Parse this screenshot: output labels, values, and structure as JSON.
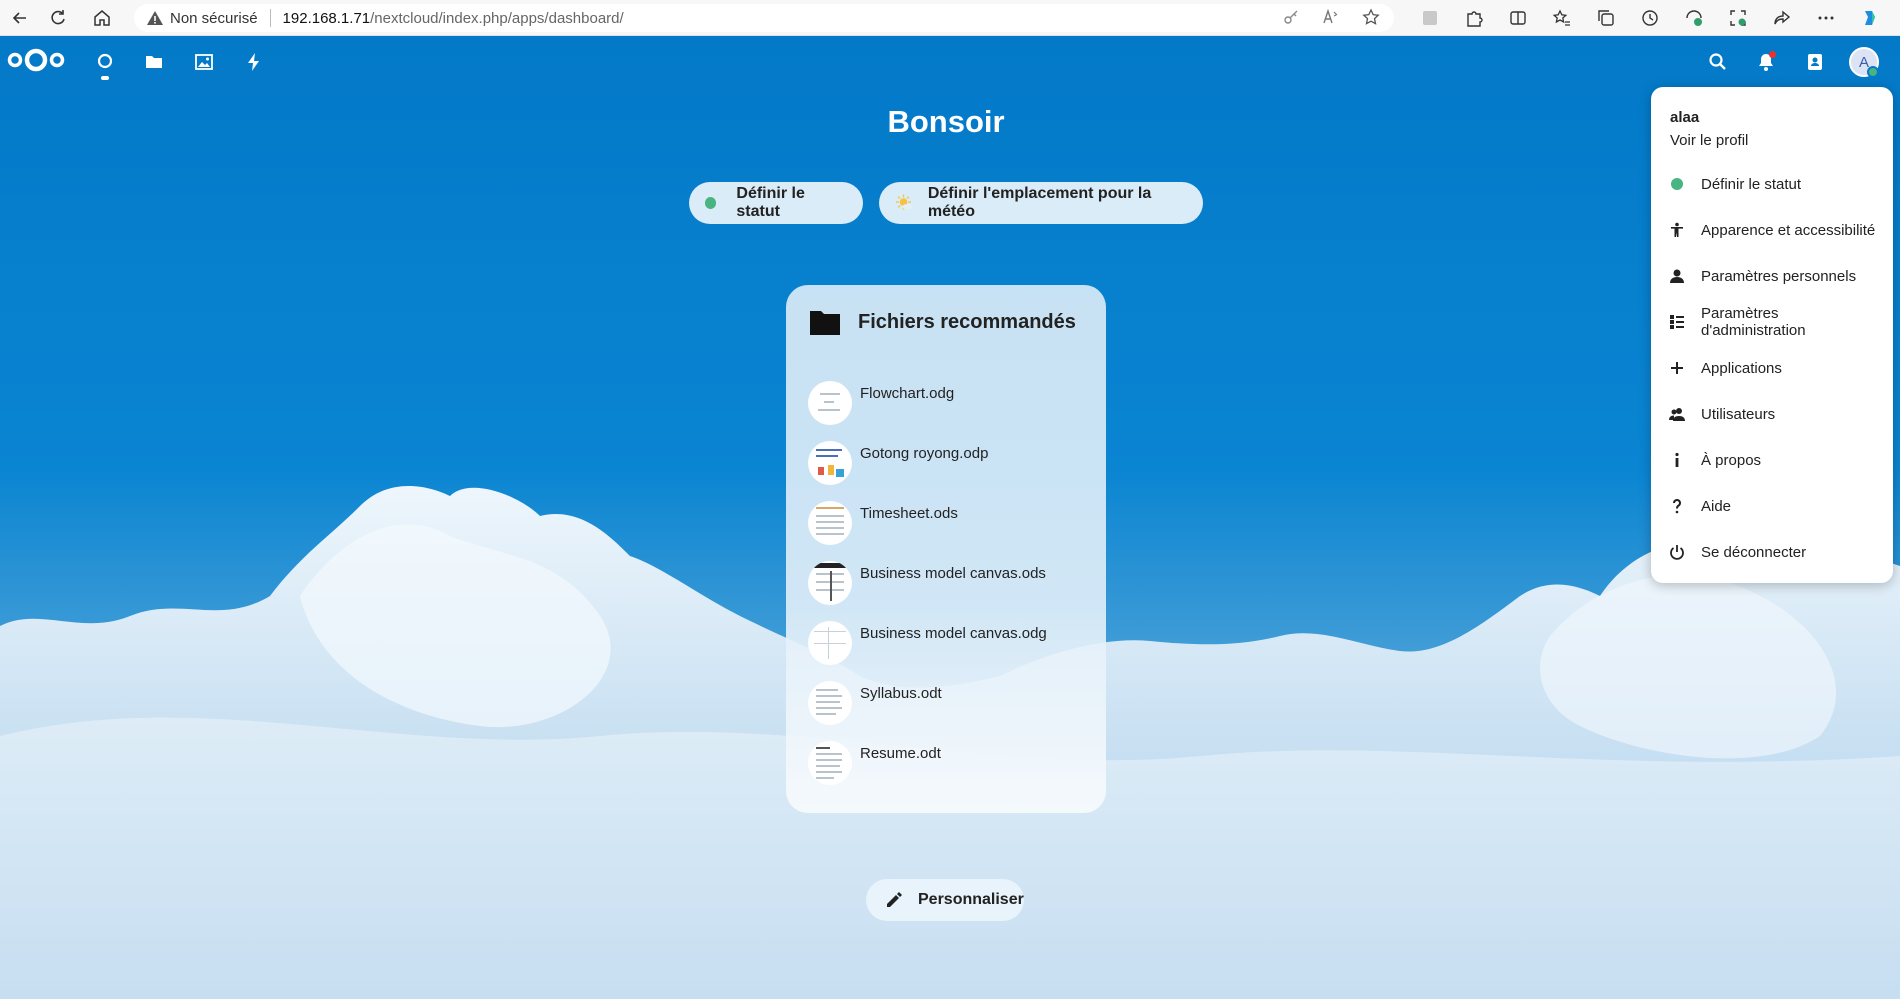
{
  "browser": {
    "security_label": "Non sécurisé",
    "url_host": "192.168.1.71",
    "url_path": "/nextcloud/index.php/apps/dashboard/"
  },
  "header": {
    "apps": [
      "dashboard-icon",
      "files-icon",
      "photos-icon",
      "activity-icon"
    ],
    "right_icons": [
      "search-icon",
      "notifications-icon",
      "contacts-icon"
    ],
    "avatar_initial": "A"
  },
  "dashboard": {
    "greeting": "Bonsoir",
    "status_button": "Définir le statut",
    "weather_button": "Définir l'emplacement pour la météo",
    "customize_button": "Personnaliser"
  },
  "widget": {
    "title": "Fichiers recommandés",
    "files": [
      {
        "name": "Flowchart.odg"
      },
      {
        "name": "Gotong royong.odp"
      },
      {
        "name": "Timesheet.ods"
      },
      {
        "name": "Business model canvas.ods"
      },
      {
        "name": "Business model canvas.odg"
      },
      {
        "name": "Syllabus.odt"
      },
      {
        "name": "Resume.odt"
      }
    ]
  },
  "user_menu": {
    "username": "alaa",
    "profile_link": "Voir le profil",
    "items": [
      {
        "label": "Définir le statut",
        "icon": "status-dot"
      },
      {
        "label": "Apparence et accessibilité",
        "icon": "accessibility-icon"
      },
      {
        "label": "Paramètres personnels",
        "icon": "user-icon"
      },
      {
        "label": "Paramètres d'administration",
        "icon": "admin-list-icon"
      },
      {
        "label": "Applications",
        "icon": "plus-icon"
      },
      {
        "label": "Utilisateurs",
        "icon": "users-icon"
      },
      {
        "label": "À propos",
        "icon": "info-icon"
      },
      {
        "label": "Aide",
        "icon": "help-icon"
      },
      {
        "label": "Se déconnecter",
        "icon": "power-icon"
      }
    ]
  },
  "colors": {
    "nextcloud_blue": "#0379c8",
    "status_green": "#49b382"
  }
}
